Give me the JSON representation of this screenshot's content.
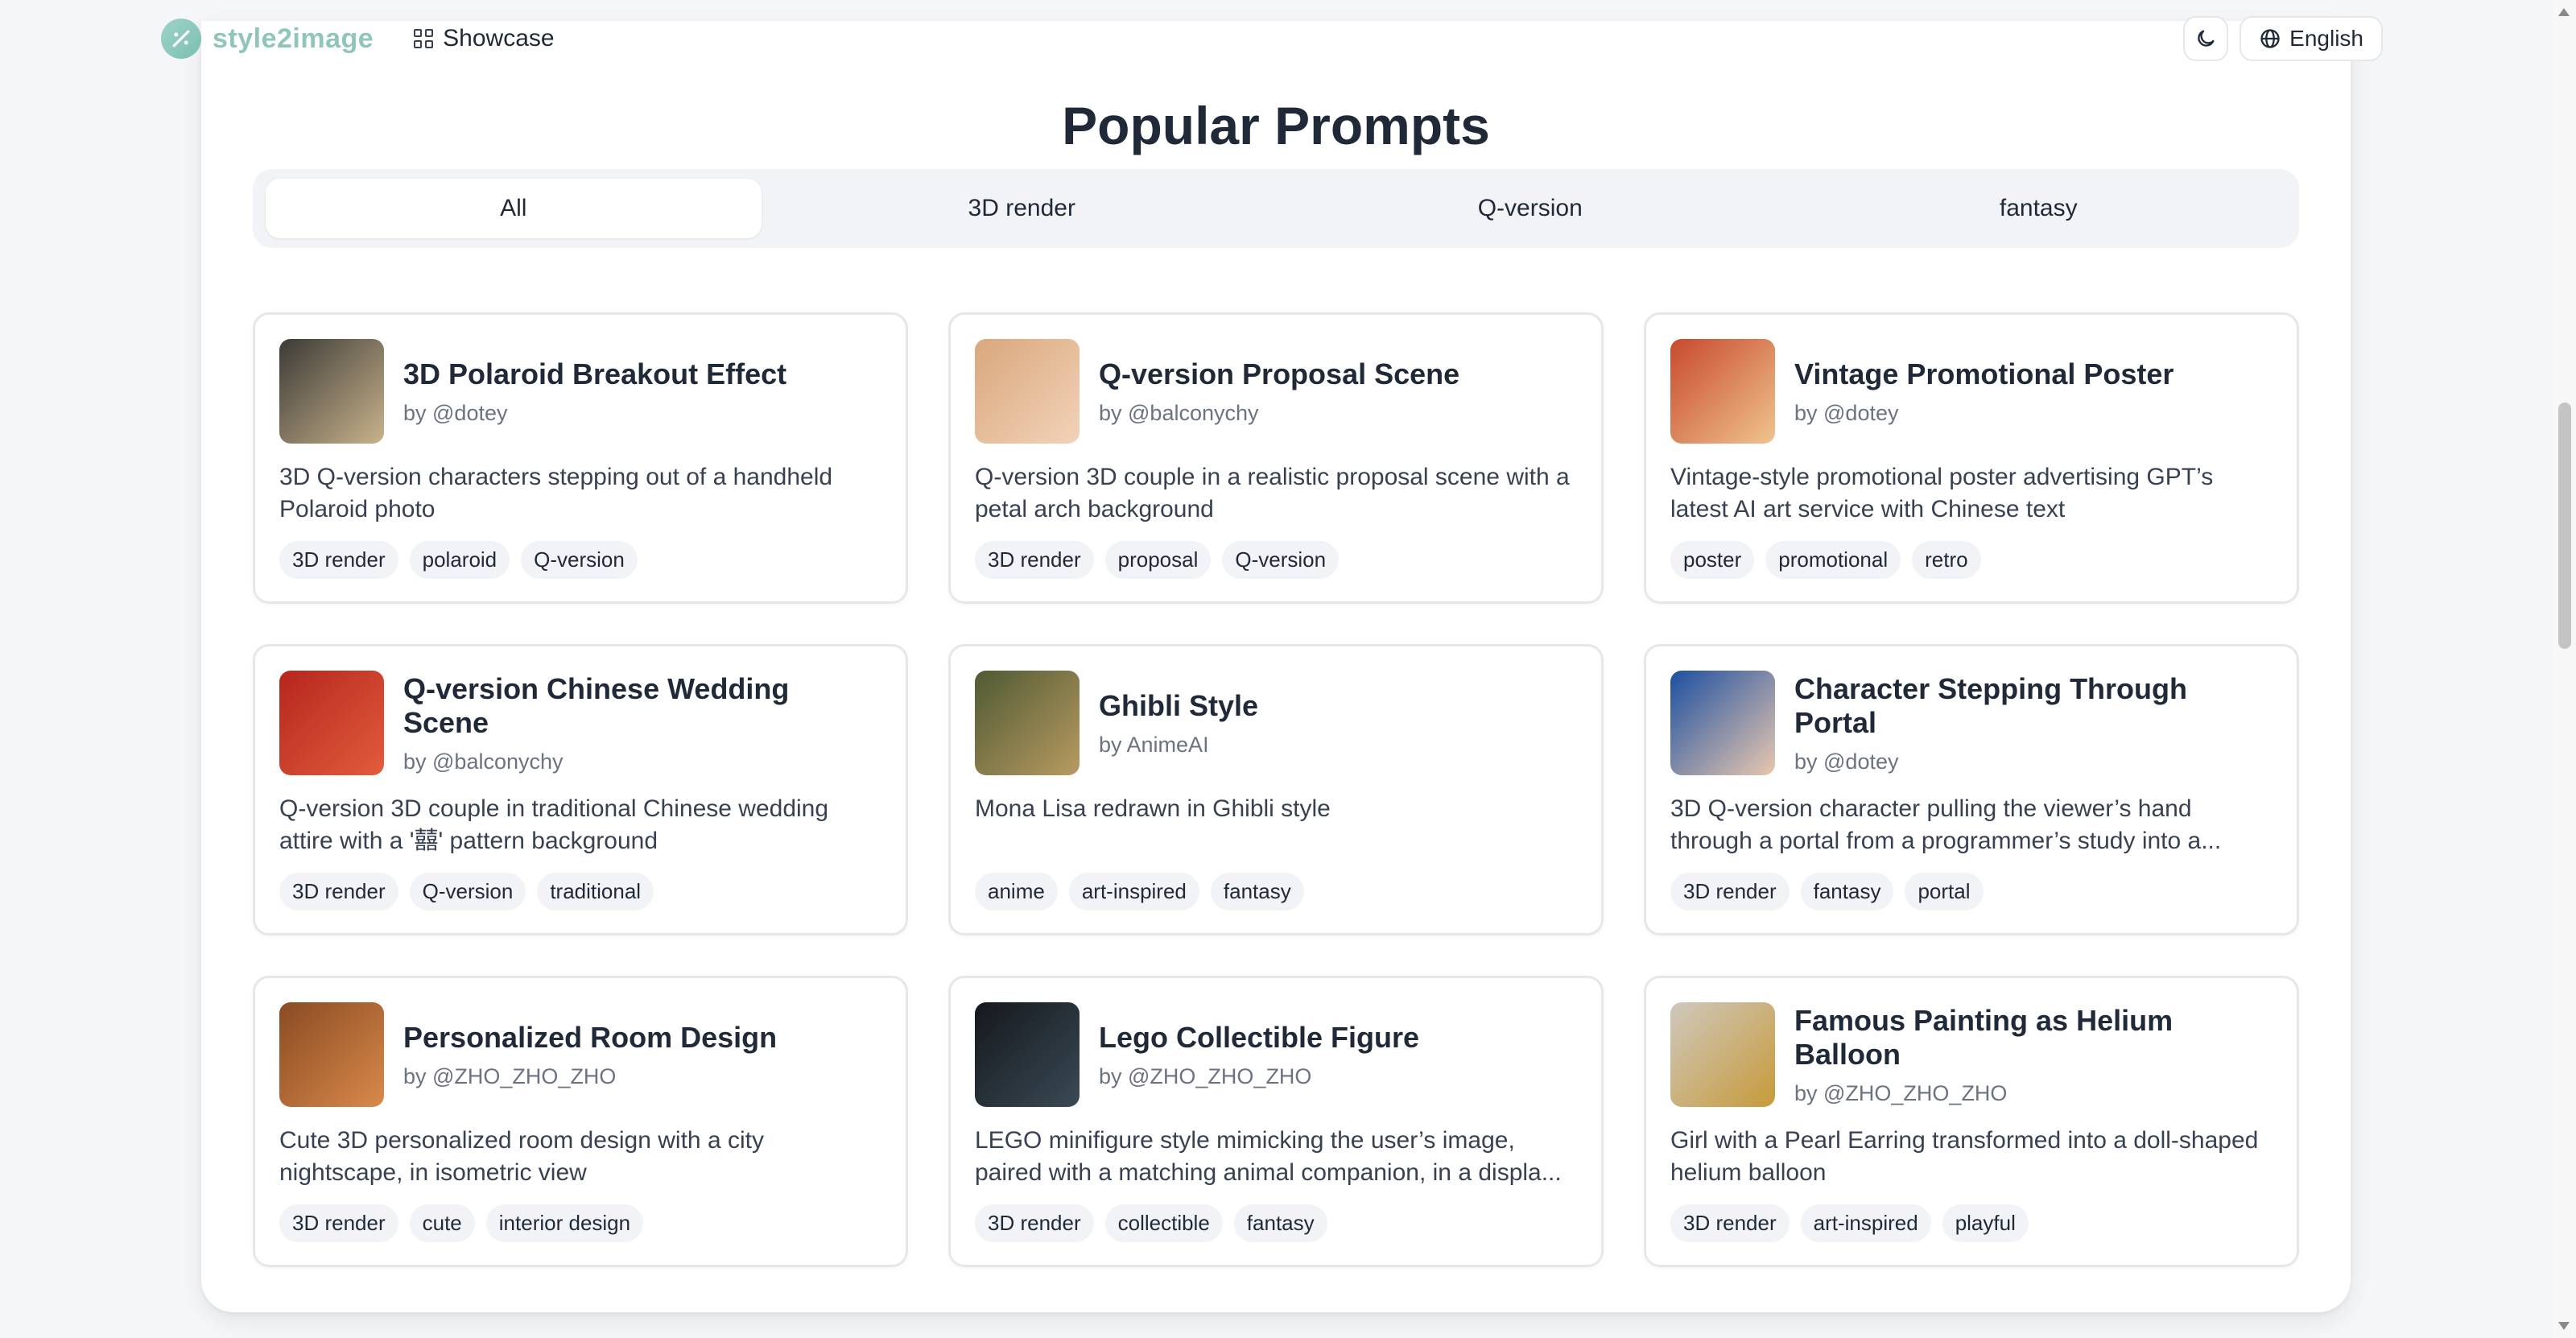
{
  "header": {
    "brand": "style2image",
    "nav_showcase": "Showcase",
    "language": "English"
  },
  "main": {
    "title": "Popular Prompts",
    "tabs": [
      {
        "label": "All",
        "active": true
      },
      {
        "label": "3D render",
        "active": false
      },
      {
        "label": "Q-version",
        "active": false
      },
      {
        "label": "fantasy",
        "active": false
      }
    ]
  },
  "cards": [
    {
      "title": "3D Polaroid Breakout Effect",
      "author": "by @dotey",
      "desc": "3D Q-version characters stepping out of a handheld Polaroid photo",
      "tags": [
        "3D render",
        "polaroid",
        "Q-version"
      ],
      "thumb": [
        "#3b3a36",
        "#c9b38b"
      ]
    },
    {
      "title": "Q-version Proposal Scene",
      "author": "by @balconychy",
      "desc": "Q-version 3D couple in a realistic proposal scene with a petal arch background",
      "tags": [
        "3D render",
        "proposal",
        "Q-version"
      ],
      "thumb": [
        "#d9a77c",
        "#f2d3b8"
      ]
    },
    {
      "title": "Vintage Promotional Poster",
      "author": "by @dotey",
      "desc": "Vintage-style promotional poster advertising GPT’s latest AI art service with Chinese text",
      "tags": [
        "poster",
        "promotional",
        "retro"
      ],
      "thumb": [
        "#c7492e",
        "#f0c48d"
      ]
    },
    {
      "title": "Q-version Chinese Wedding Scene",
      "author": "by @balconychy",
      "desc": "Q-version 3D couple in traditional Chinese wedding attire with a '囍' pattern background",
      "tags": [
        "3D render",
        "Q-version",
        "traditional"
      ],
      "thumb": [
        "#b5261d",
        "#e25c3c"
      ]
    },
    {
      "title": "Ghibli Style",
      "author": "by AnimeAI",
      "desc": "Mona Lisa redrawn in Ghibli style",
      "tags": [
        "anime",
        "art-inspired",
        "fantasy"
      ],
      "thumb": [
        "#4f5a33",
        "#b89a61"
      ]
    },
    {
      "title": "Character Stepping Through Portal",
      "author": "by @dotey",
      "desc": "3D Q-version character pulling the viewer’s hand through a portal from a programmer’s study into a...",
      "tags": [
        "3D render",
        "fantasy",
        "portal"
      ],
      "thumb": [
        "#1c4fa0",
        "#e8c8b0"
      ]
    },
    {
      "title": "Personalized Room Design",
      "author": "by @ZHO_ZHO_ZHO",
      "desc": "Cute 3D personalized room design with a city nightscape, in isometric view",
      "tags": [
        "3D render",
        "cute",
        "interior design"
      ],
      "thumb": [
        "#8a4a22",
        "#d88a4a"
      ]
    },
    {
      "title": "Lego Collectible Figure",
      "author": "by @ZHO_ZHO_ZHO",
      "desc": "LEGO minifigure style mimicking the user’s image, paired with a matching animal companion, in a displa...",
      "tags": [
        "3D render",
        "collectible",
        "fantasy"
      ],
      "thumb": [
        "#14181c",
        "#3a4a55"
      ]
    },
    {
      "title": "Famous Painting as Helium Balloon",
      "author": "by @ZHO_ZHO_ZHO",
      "desc": "Girl with a Pearl Earring transformed into a doll-shaped helium balloon",
      "tags": [
        "3D render",
        "art-inspired",
        "playful"
      ],
      "thumb": [
        "#cfc8be",
        "#c79a3a"
      ]
    }
  ]
}
